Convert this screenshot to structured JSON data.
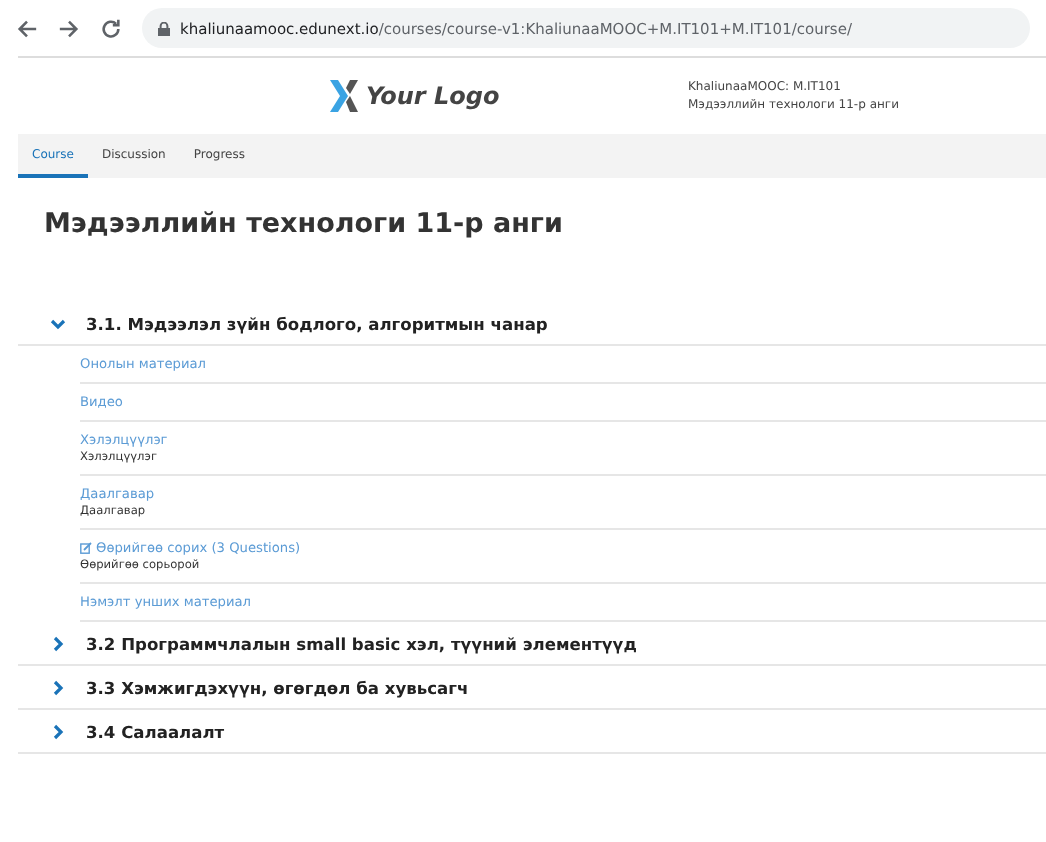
{
  "browser": {
    "url_host": "khaliunaamooc.edunext.io",
    "url_path": "/courses/course-v1:KhaliunaaMOOC+M.IT101+M.IT101/course/"
  },
  "header": {
    "logo_text": "Your Logo",
    "course_code": "KhaliunaaMOOC: M.IT101",
    "course_name": "Мэдээллийн технологи 11-р анги"
  },
  "tabs": [
    {
      "label": "Course",
      "selected": true
    },
    {
      "label": "Discussion",
      "selected": false
    },
    {
      "label": "Progress",
      "selected": false
    }
  ],
  "page_title": "Мэдээллийн технологи 11-р анги",
  "sections": [
    {
      "title": "3.1. Мэдээлэл зүйн бодлого, алгоритмын чанар",
      "expanded": true,
      "units": [
        {
          "title": "Онолын материал"
        },
        {
          "title": "Видео"
        },
        {
          "title": "Хэлэлцүүлэг",
          "subtitle": "Хэлэлцүүлэг"
        },
        {
          "title": "Даалгавар",
          "subtitle": "Даалгавар"
        },
        {
          "title": "Өөрийгөө сорих (3 Questions)",
          "subtitle": "Өөрийгөө сорьорой",
          "kind": "quiz"
        },
        {
          "title": "Нэмэлт унших материал"
        }
      ]
    },
    {
      "title": "3.2 Программчлалын small basic хэл, түүний элементүүд",
      "expanded": false
    },
    {
      "title": "3.3 Хэмжигдэхүүн, өгөгдөл ба хувьсагч",
      "expanded": false
    },
    {
      "title": "3.4 Салаалалт",
      "expanded": false
    }
  ]
}
